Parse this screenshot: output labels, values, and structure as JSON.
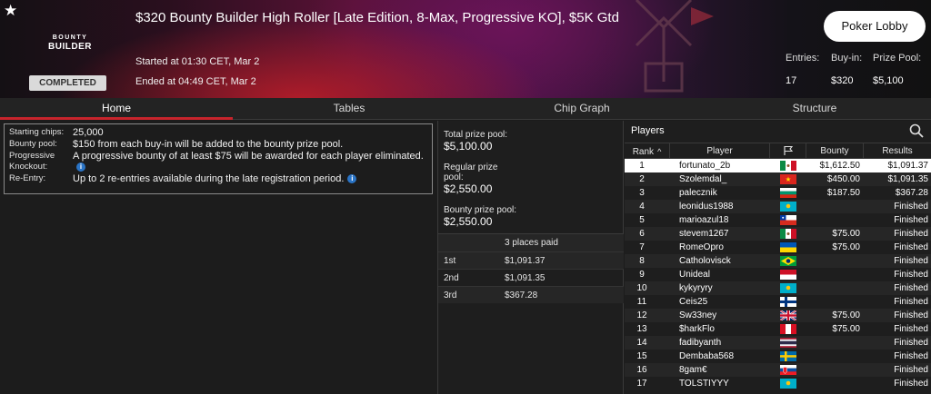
{
  "header": {
    "logo_top": "BOUNTY",
    "logo_bottom": "BUILDER",
    "status": "COMPLETED",
    "title": "$320 Bounty Builder High Roller [Late Edition, 8-Max, Progressive KO], $5K Gtd",
    "started": "Started at 01:30 CET, Mar 2",
    "ended": "Ended at 04:49 CET, Mar 2",
    "lobby_button": "Poker Lobby",
    "stats": {
      "entries_label": "Entries:",
      "entries": "17",
      "buyin_label": "Buy-in:",
      "buyin": "$320",
      "pool_label": "Prize Pool:",
      "pool": "$5,100"
    }
  },
  "tabs": [
    "Home",
    "Tables",
    "Chip Graph",
    "Structure"
  ],
  "info": [
    {
      "key": "Starting chips:",
      "value": "25,000",
      "icon": false
    },
    {
      "key": "Bounty pool:",
      "value": "$150 from each buy-in will be added to the bounty prize pool.",
      "icon": false
    },
    {
      "key": "Progressive Knockout:",
      "value": "A progressive bounty of at least $75 will be awarded for each player eliminated.",
      "icon": true
    },
    {
      "key": "Re-Entry:",
      "value": "Up to 2 re-entries available during the late registration period.",
      "icon": true
    }
  ],
  "prizes": {
    "total_label": "Total prize pool:",
    "total": "$5,100.00",
    "regular_label": "Regular prize pool:",
    "regular": "$2,550.00",
    "bounty_label": "Bounty prize pool:",
    "bounty": "$2,550.00",
    "places_header": "3 places paid",
    "places": [
      {
        "place": "1st",
        "amount": "$1,091.37"
      },
      {
        "place": "2nd",
        "amount": "$1,091.35"
      },
      {
        "place": "3rd",
        "amount": "$367.28"
      }
    ]
  },
  "players": {
    "title": "Players",
    "col_rank": "Rank",
    "col_player": "Player",
    "col_bounty": "Bounty",
    "col_results": "Results",
    "rows": [
      {
        "rank": "1",
        "name": "fortunato_2b",
        "flag": "mx",
        "bounty": "$1,612.50",
        "result": "$1,091.37"
      },
      {
        "rank": "2",
        "name": "Szolemdal_",
        "flag": "vn",
        "bounty": "$450.00",
        "result": "$1,091.35"
      },
      {
        "rank": "3",
        "name": "palecznik",
        "flag": "bg",
        "bounty": "$187.50",
        "result": "$367.28"
      },
      {
        "rank": "4",
        "name": "leonidus1988",
        "flag": "kz",
        "bounty": "",
        "result": "Finished"
      },
      {
        "rank": "5",
        "name": "marioazul18",
        "flag": "cl",
        "bounty": "",
        "result": "Finished"
      },
      {
        "rank": "6",
        "name": "stevem1267",
        "flag": "mx",
        "bounty": "$75.00",
        "result": "Finished"
      },
      {
        "rank": "7",
        "name": "RomeOpro",
        "flag": "ua",
        "bounty": "$75.00",
        "result": "Finished"
      },
      {
        "rank": "8",
        "name": "Catholovisck",
        "flag": "br",
        "bounty": "",
        "result": "Finished"
      },
      {
        "rank": "9",
        "name": "Unideal",
        "flag": "id",
        "bounty": "",
        "result": "Finished"
      },
      {
        "rank": "10",
        "name": "kykyryry",
        "flag": "kz",
        "bounty": "",
        "result": "Finished"
      },
      {
        "rank": "11",
        "name": "Ceis25",
        "flag": "fi",
        "bounty": "",
        "result": "Finished"
      },
      {
        "rank": "12",
        "name": "Sw33ney",
        "flag": "gb",
        "bounty": "$75.00",
        "result": "Finished"
      },
      {
        "rank": "13",
        "name": "$harkFlo",
        "flag": "pe",
        "bounty": "$75.00",
        "result": "Finished"
      },
      {
        "rank": "14",
        "name": "fadibyanth",
        "flag": "th",
        "bounty": "",
        "result": "Finished"
      },
      {
        "rank": "15",
        "name": "Dembaba568",
        "flag": "se",
        "bounty": "",
        "result": "Finished"
      },
      {
        "rank": "16",
        "name": "8gam€",
        "flag": "sk",
        "bounty": "",
        "result": "Finished"
      },
      {
        "rank": "17",
        "name": "TOLSTIYYY",
        "flag": "kz",
        "bounty": "",
        "result": "Finished"
      }
    ]
  }
}
